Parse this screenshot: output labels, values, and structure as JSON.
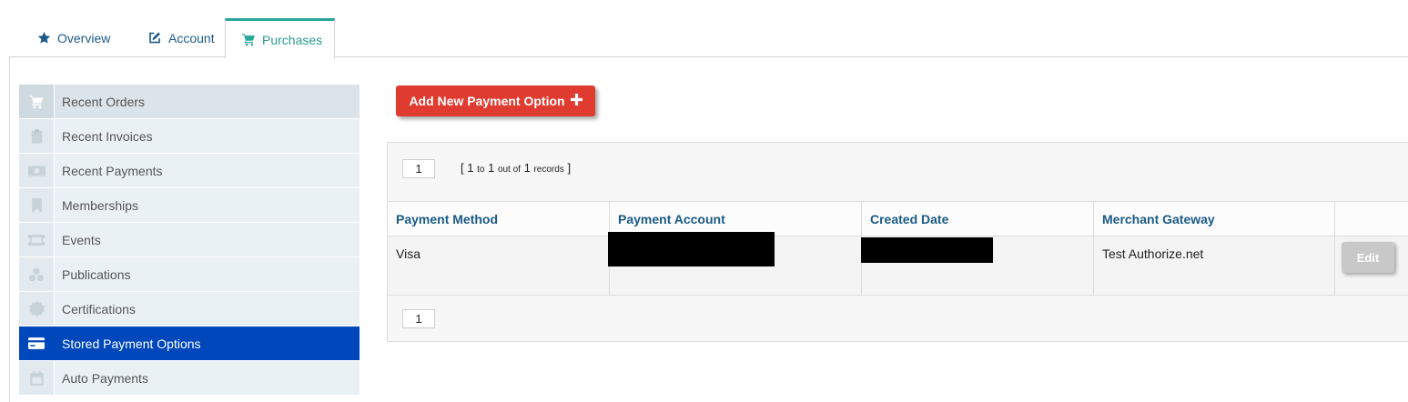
{
  "tabs": [
    {
      "label": "Overview",
      "icon": "star-icon"
    },
    {
      "label": "Account",
      "icon": "edit-icon"
    },
    {
      "label": "Purchases",
      "icon": "cart-icon",
      "active": true
    }
  ],
  "sidebar": {
    "items": [
      {
        "label": "Recent Orders",
        "icon": "cart-icon"
      },
      {
        "label": "Recent Invoices",
        "icon": "clipboard-icon"
      },
      {
        "label": "Recent Payments",
        "icon": "money-icon"
      },
      {
        "label": "Memberships",
        "icon": "bookmark-icon"
      },
      {
        "label": "Events",
        "icon": "ticket-icon"
      },
      {
        "label": "Publications",
        "icon": "cubes-icon"
      },
      {
        "label": "Certifications",
        "icon": "certificate-icon"
      },
      {
        "label": "Stored Payment Options",
        "icon": "credit-card-icon",
        "active": true
      },
      {
        "label": "Auto Payments",
        "icon": "calendar-icon"
      }
    ]
  },
  "actions": {
    "add_payment_label": "Add New Payment Option",
    "add_payment_icon": "plus-icon"
  },
  "grid": {
    "top_page": "1",
    "bottom_page": "1",
    "pager_info": {
      "open": "[",
      "from": "1",
      "to_word": "to",
      "to": "1",
      "out_of_word": "out of",
      "total": "1",
      "records_word": "records",
      "close": "]"
    },
    "columns": [
      "Payment Method",
      "Payment Account",
      "Created Date",
      "Merchant Gateway",
      ""
    ],
    "rows": [
      {
        "payment_method": "Visa",
        "payment_account": "",
        "created_date": "",
        "merchant_gateway": "Test Authorize.net",
        "action_label": "Edit"
      }
    ]
  },
  "colors": {
    "active_sidebar": "#0047bb",
    "active_tab": "#26a69a",
    "add_button": "#e03b30",
    "header_text": "#1a5a86",
    "edit_button": "#c8c8c8"
  }
}
